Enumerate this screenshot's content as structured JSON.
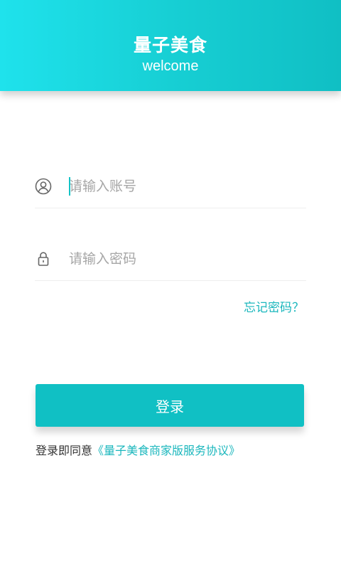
{
  "header": {
    "title": "量子美食",
    "subtitle": "welcome"
  },
  "account": {
    "icon": "user-circle-icon",
    "placeholder": "请输入账号",
    "value": ""
  },
  "password": {
    "icon": "lock-icon",
    "placeholder": "请输入密码",
    "value": ""
  },
  "forgot_password_label": "忘记密码？",
  "login_button_label": "登录",
  "agreement": {
    "prefix": "登录即同意",
    "link_text": "《量子美食商家版服务协议》"
  },
  "colors": {
    "accent": "#10c0c4",
    "header_gradient_start": "#1fe2ec",
    "header_gradient_end": "#10bfc4",
    "link": "#1bb7bd",
    "placeholder": "#a6a6a6"
  }
}
